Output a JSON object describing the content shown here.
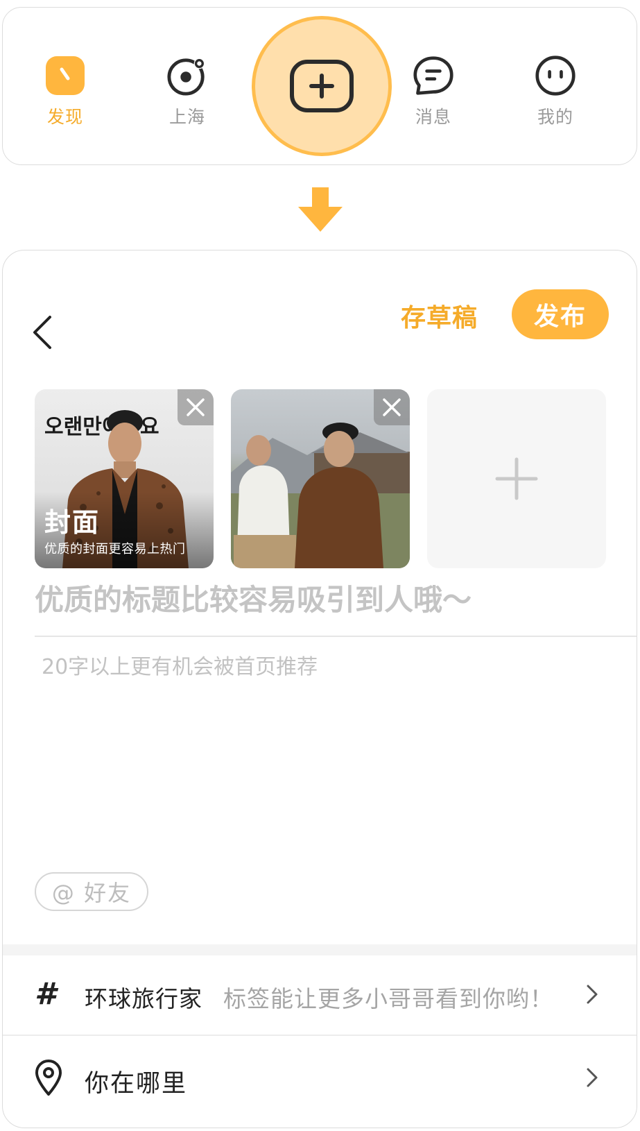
{
  "tabbar": {
    "tabs": [
      {
        "label": "发现",
        "icon": "discover-icon",
        "active": true
      },
      {
        "label": "上海",
        "icon": "city-icon",
        "active": false
      },
      {
        "label": "消息",
        "icon": "message-icon",
        "active": false
      },
      {
        "label": "我的",
        "icon": "profile-icon",
        "active": false
      }
    ],
    "publish_icon": "plus-icon",
    "accent_color": "#f5ab2a"
  },
  "editor": {
    "back_icon": "chevron-left-icon",
    "save_draft_label": "存草稿",
    "publish_label": "发布",
    "images": [
      {
        "is_cover": true,
        "cover_title": "封面",
        "cover_subtitle": "优质的封面更容易上热门",
        "photo_caption": "오랜만이네요"
      },
      {
        "is_cover": false
      }
    ],
    "add_image_icon": "plus-icon",
    "title_placeholder": "优质的标题比较容易吸引到人哦～",
    "body_placeholder": "20字以上更有机会被首页推荐",
    "mention_label": "@ 好友",
    "topic": {
      "name": "环球旅行家",
      "hint": "标签能让更多小哥哥看到你哟！"
    },
    "location": {
      "label": "你在哪里"
    }
  }
}
